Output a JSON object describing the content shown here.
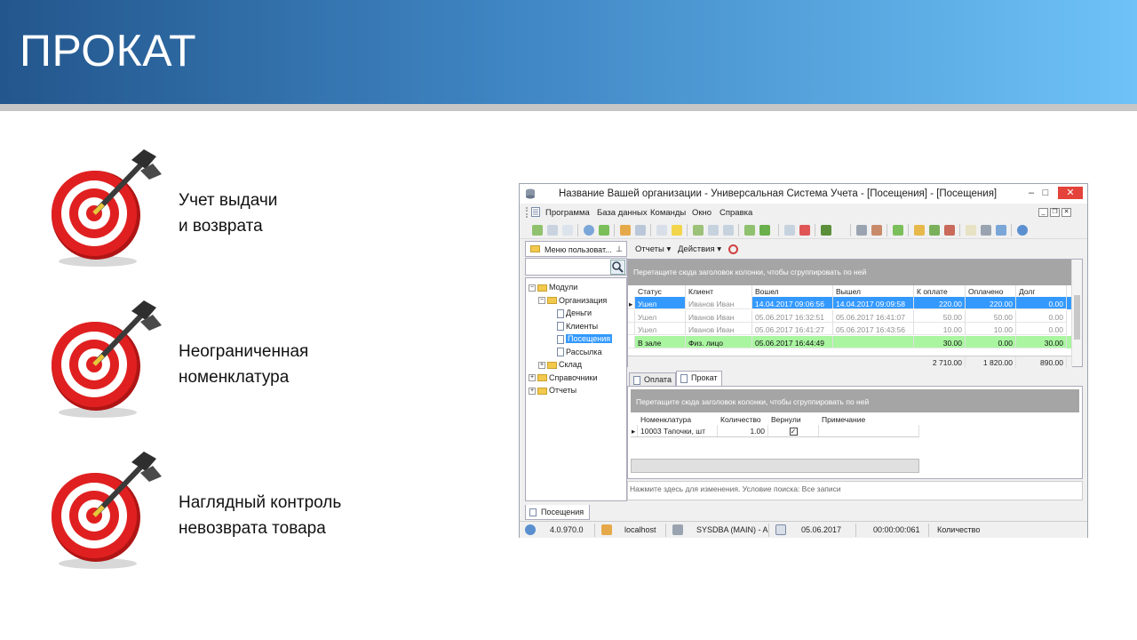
{
  "slide": {
    "title": "ПРОКАТ",
    "bullets": [
      {
        "line1": "Учет выдачи",
        "line2": "и возврата"
      },
      {
        "line1": "Неограниченная",
        "line2": "номенклатура"
      },
      {
        "line1": "Наглядный контроль",
        "line2": "невозврата товара"
      }
    ],
    "colors": {
      "banner_start": "#23568c",
      "banner_end": "#6ec2f7",
      "target_red": "#e02020"
    }
  },
  "window": {
    "title": "Название Вашей организации - Универсальная Система Учета - [Посещения] - [Посещения]",
    "controls": {
      "minimize": "–",
      "maximize": "□",
      "close": "✕"
    },
    "menu": [
      "Программа",
      "База данных",
      "Команды",
      "Окно",
      "Справка"
    ],
    "left_panel": {
      "tab_label": "Меню пользоват...",
      "tree": [
        {
          "label": "Модули",
          "level": 0,
          "type": "folder",
          "expander": "−"
        },
        {
          "label": "Организация",
          "level": 1,
          "type": "folder",
          "expander": "−"
        },
        {
          "label": "Деньги",
          "level": 2,
          "type": "doc"
        },
        {
          "label": "Клиенты",
          "level": 2,
          "type": "doc"
        },
        {
          "label": "Посещения",
          "level": 2,
          "type": "doc",
          "selected": true
        },
        {
          "label": "Рассылка",
          "level": 2,
          "type": "doc"
        },
        {
          "label": "Склад",
          "level": 1,
          "type": "folder",
          "expander": "+"
        },
        {
          "label": "Справочники",
          "level": 0,
          "type": "folder",
          "expander": "+"
        },
        {
          "label": "Отчеты",
          "level": 0,
          "type": "folder",
          "expander": "+"
        }
      ]
    },
    "right_toolbar": {
      "reports": "Отчеты ▾",
      "actions": "Действия ▾"
    },
    "main_grid": {
      "group_hint": "Перетащите сюда заголовок колонки, чтобы сгруппировать по ней",
      "columns": [
        "Статус",
        "Клиент",
        "Вошел",
        "Вышел",
        "К оплате",
        "Оплачено",
        "Долг"
      ],
      "rows": [
        {
          "cells": [
            "Ушел",
            "Иванов Иван",
            "14.04.2017 09:06:56",
            "14.04.2017 09:09:58",
            "220.00",
            "220.00",
            "0.00"
          ],
          "style": "selected"
        },
        {
          "cells": [
            "Ушел",
            "Иванов Иван",
            "05.06.2017 16:32:51",
            "05.06.2017 16:41:07",
            "50.00",
            "50.00",
            "0.00"
          ],
          "style": "grey"
        },
        {
          "cells": [
            "Ушел",
            "Иванов Иван",
            "05.06.2017 16:41:27",
            "05.06.2017 16:43:56",
            "10.00",
            "10.00",
            "0.00"
          ],
          "style": "grey"
        },
        {
          "cells": [
            "В зале",
            "Физ. лицо",
            "05.06.2017 16:44:49",
            "",
            "30.00",
            "0.00",
            "30.00"
          ],
          "style": "green"
        }
      ],
      "totals": {
        "to_pay": "2 710.00",
        "paid": "1 820.00",
        "debt": "890.00"
      }
    },
    "detail_tabs": [
      "Оплата",
      "Прокат"
    ],
    "detail_grid": {
      "group_hint": "Перетащите сюда заголовок колонки, чтобы сгруппировать по ней",
      "columns": [
        "Номенклатура",
        "Количество",
        "Вернули",
        "Примечание"
      ],
      "row": {
        "item": "10003 Тапочки, шт",
        "qty": "1.00",
        "returned": "✓",
        "note": ""
      }
    },
    "filter_text": "Нажмите здесь для изменения. Условие поиска: Все записи",
    "bottom_tab": "Посещения",
    "status": {
      "version": "4.0.970.0",
      "host": "localhost",
      "user": "SYSDBA (MAIN) - A",
      "date": "05.06.2017",
      "timer": "00:00:00:061",
      "field": "Количество"
    }
  }
}
